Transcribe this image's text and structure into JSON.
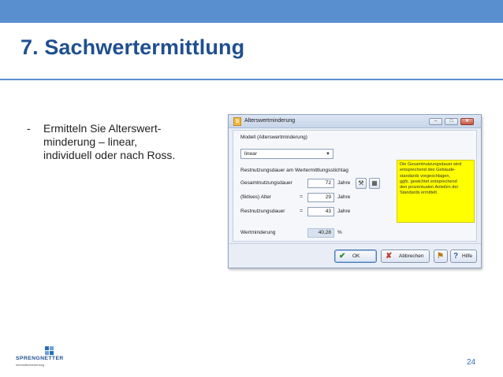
{
  "slide": {
    "title": "7. Sachwertermittlung",
    "bullet_dash": "-",
    "bullet_lines": [
      "Ermitteln Sie Alterswert-",
      "minderung – linear,",
      "individuell oder nach Ross."
    ],
    "page_number": "24"
  },
  "brand": {
    "name": "SPRENGNETTER",
    "tagline": "Immobilienbewertung",
    "color": "#1f4f8f"
  },
  "colors": {
    "accent_bar": "#5a8fcf",
    "title": "#1f4f8f",
    "note_bg": "#ffff00"
  },
  "dialog": {
    "app_icon": "S",
    "title": "Alterswertminderung",
    "window_buttons": {
      "minimize": "–",
      "maximize": "□",
      "close": "✕"
    },
    "model": {
      "group_label": "Modell (Alterswertminderung)",
      "selected": "linear"
    },
    "remaining": {
      "group_label": "Restnutzungsdauer am Wertermittlungsstichtag",
      "rows": [
        {
          "label": "Gesamtnutzungsdauer",
          "eq": "",
          "value": "72",
          "unit": "Jahre"
        },
        {
          "label": "(fiktives) Alter",
          "eq": "=",
          "value": "29",
          "unit": "Jahre"
        },
        {
          "label": "Restnutzungsdauer",
          "eq": "=",
          "value": "43",
          "unit": "Jahre"
        }
      ]
    },
    "note_lines": [
      "Die Gesamtnutzungsdauer wird",
      "entsprechend des Gebäude-",
      "standards vorgeschlagen,",
      "ggfs. gewichtet entsprechend",
      "den prozentualen Anteilen der",
      "Standards ermittelt."
    ],
    "depreciation": {
      "label": "Wertminderung",
      "value": "40,28",
      "unit": "%"
    },
    "buttons": {
      "ok": "OK",
      "cancel": "Abbrechen",
      "help": "Hilfe"
    }
  }
}
